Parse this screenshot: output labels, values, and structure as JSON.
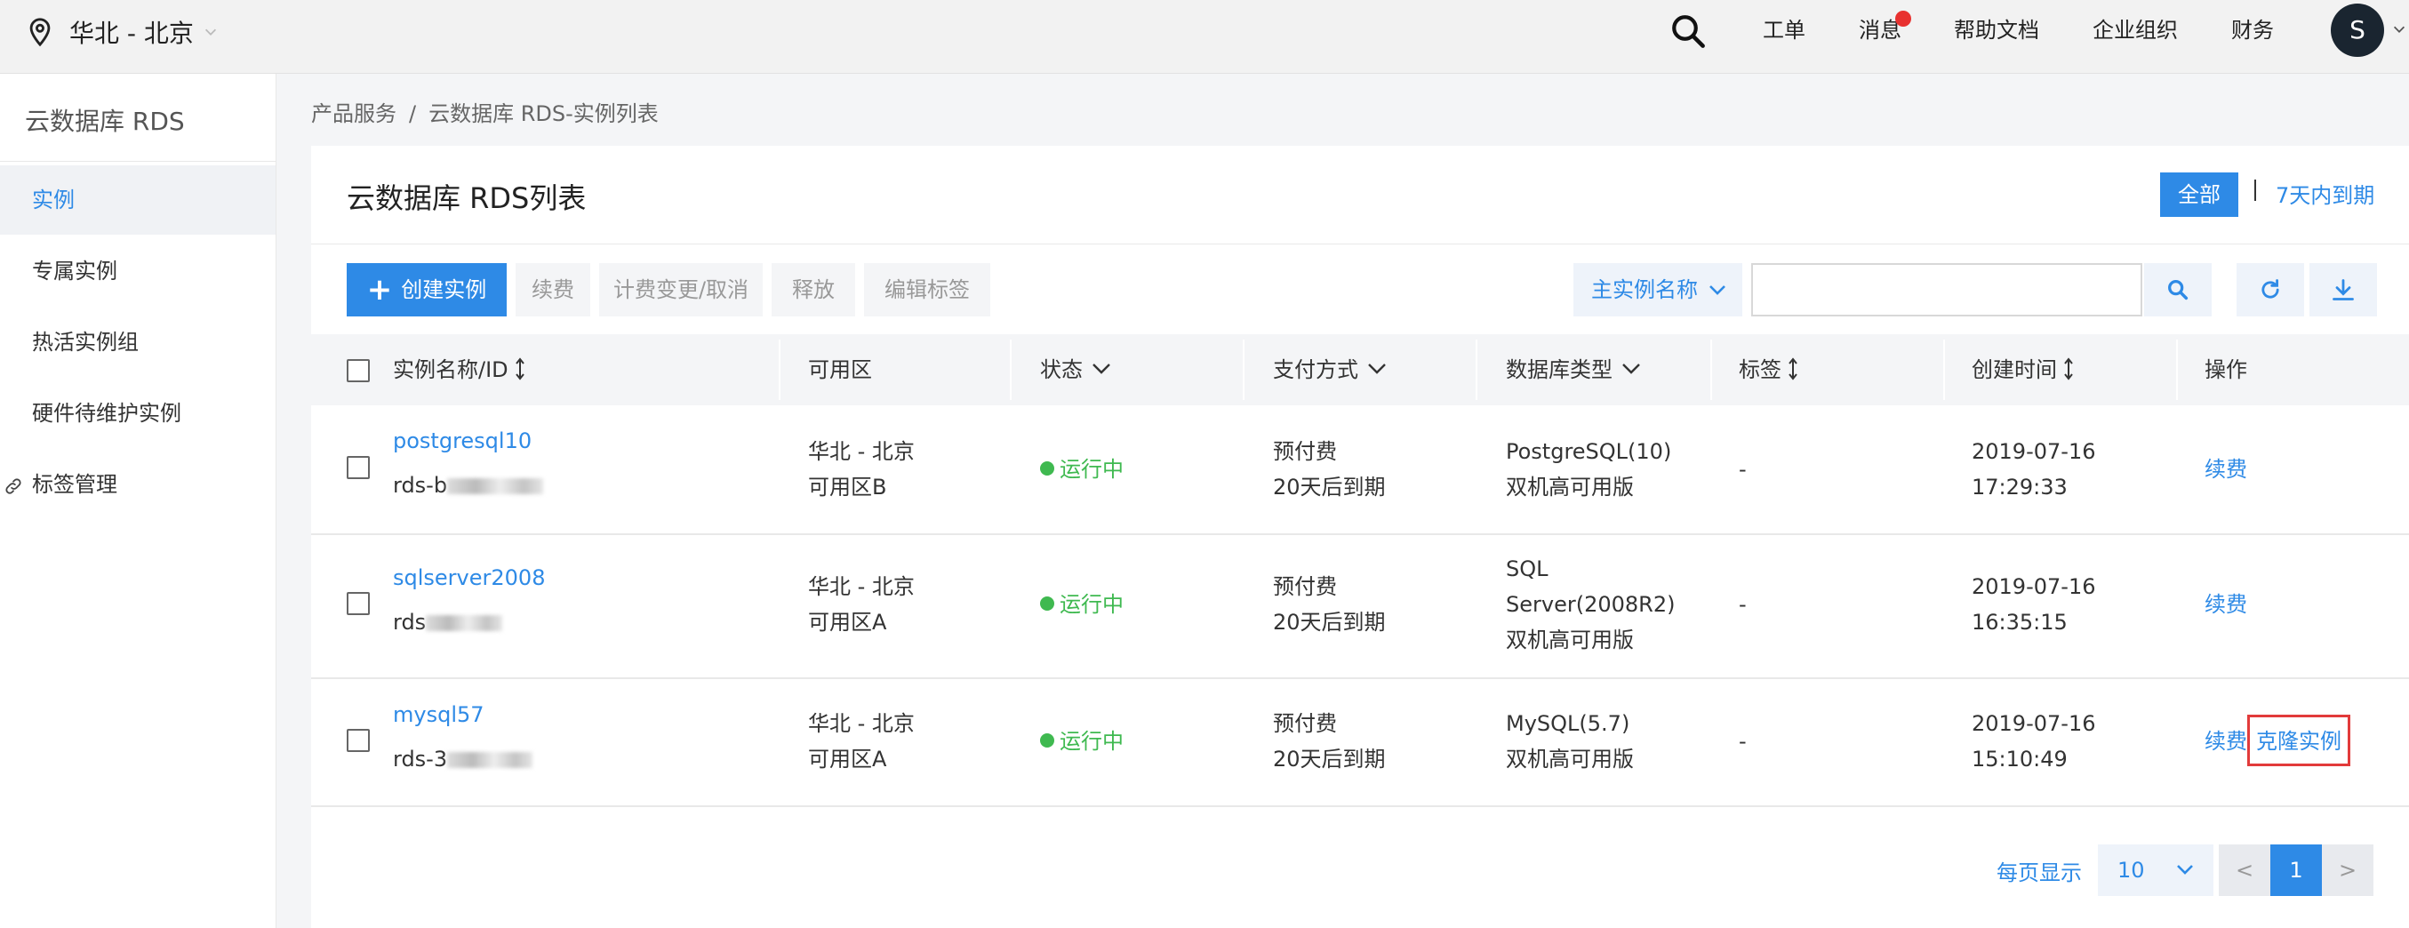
{
  "topbar": {
    "region": "华北 - 北京",
    "nav": [
      "工单",
      "消息",
      "帮助文档",
      "企业组织",
      "财务"
    ],
    "avatar_initial": "S"
  },
  "sidebar": {
    "title": "云数据库 RDS",
    "items": [
      {
        "label": "实例",
        "active": true
      },
      {
        "label": "专属实例"
      },
      {
        "label": "热活实例组"
      },
      {
        "label": "硬件待维护实例"
      },
      {
        "label": "标签管理"
      }
    ]
  },
  "breadcrumb": [
    "产品服务",
    "云数据库 RDS-实例列表"
  ],
  "breadcrumb_separator": "/",
  "panel": {
    "title": "云数据库 RDS列表",
    "filter_all": "全部",
    "filter_7days": "7天内到期",
    "toolbar": {
      "create": "创建实例",
      "renew": "续费",
      "billing_change": "计费变更/取消",
      "release": "释放",
      "edit_tags": "编辑标签",
      "search_field": "主实例名称",
      "search_value": ""
    },
    "columns": [
      "实例名称/ID",
      "可用区",
      "状态",
      "支付方式",
      "数据库类型",
      "标签",
      "创建时间",
      "操作"
    ],
    "rows": [
      {
        "name": "postgresql10",
        "id_prefix": "rds-b",
        "zone": [
          "华北 - 北京",
          "可用区B"
        ],
        "status": "运行中",
        "payment": [
          "预付费",
          "20天后到期"
        ],
        "dbtype": [
          "PostgreSQL(10)",
          "双机高可用版"
        ],
        "tag": "-",
        "created": [
          "2019-07-16",
          "17:29:33"
        ],
        "actions": [
          "续费"
        ]
      },
      {
        "name": "sqlserver2008",
        "id_prefix": "rds",
        "zone": [
          "华北 - 北京",
          "可用区A"
        ],
        "status": "运行中",
        "payment": [
          "预付费",
          "20天后到期"
        ],
        "dbtype": [
          "SQL",
          "Server(2008R2)",
          "双机高可用版"
        ],
        "tag": "-",
        "created": [
          "2019-07-16",
          "16:35:15"
        ],
        "actions": [
          "续费"
        ]
      },
      {
        "name": "mysql57",
        "id_prefix": "rds-3",
        "zone": [
          "华北 - 北京",
          "可用区A"
        ],
        "status": "运行中",
        "payment": [
          "预付费",
          "20天后到期"
        ],
        "dbtype": [
          "MySQL(5.7)",
          "双机高可用版"
        ],
        "tag": "-",
        "created": [
          "2019-07-16",
          "15:10:49"
        ],
        "actions": [
          "续费",
          "克隆实例"
        ]
      }
    ]
  },
  "pagination": {
    "per_page_label": "每页显示",
    "per_page": "10",
    "prev": "<",
    "current": "1",
    "next": ">"
  },
  "colors": {
    "accent": "#2e8ae6",
    "status_running": "#3fb950",
    "highlight_box": "#e23b3b",
    "notification_dot": "#e8312f"
  }
}
